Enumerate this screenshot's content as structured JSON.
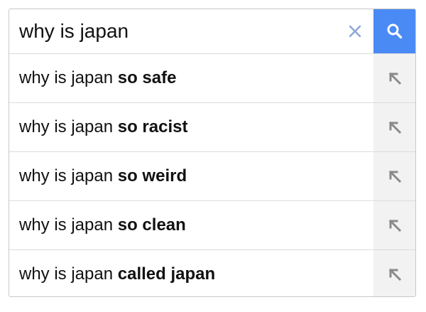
{
  "search": {
    "query": "why is japan",
    "clear_icon": "close-icon",
    "submit_icon": "search-icon",
    "accent_color": "#4a8af4"
  },
  "suggestions": [
    {
      "prefix": "why is japan ",
      "completion": "so safe",
      "icon": "arrow-up-left-icon"
    },
    {
      "prefix": "why is japan ",
      "completion": "so racist",
      "icon": "arrow-up-left-icon"
    },
    {
      "prefix": "why is japan ",
      "completion": "so weird",
      "icon": "arrow-up-left-icon"
    },
    {
      "prefix": "why is japan ",
      "completion": "so clean",
      "icon": "arrow-up-left-icon"
    },
    {
      "prefix": "why is japan ",
      "completion": "called japan",
      "icon": "arrow-up-left-icon"
    }
  ]
}
